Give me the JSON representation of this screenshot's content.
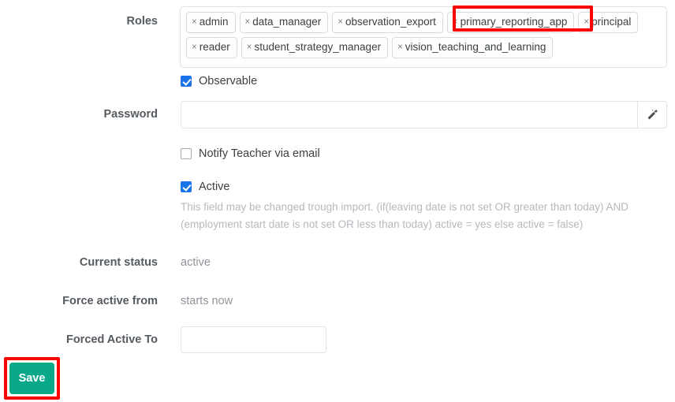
{
  "colors": {
    "accent_blue": "#1a73e8",
    "save_green": "#0aa88a",
    "highlight_red": "#ff0000",
    "border_grey": "#e2e4e7",
    "muted_text": "#8f9499"
  },
  "form": {
    "roles": {
      "label": "Roles",
      "remove_glyph": "×",
      "tags": [
        {
          "label": "admin",
          "highlighted": false
        },
        {
          "label": "data_manager",
          "highlighted": false
        },
        {
          "label": "observation_export",
          "highlighted": false
        },
        {
          "label": "primary_reporting_app",
          "highlighted": true
        },
        {
          "label": "principal",
          "highlighted": false
        },
        {
          "label": "reader",
          "highlighted": false
        },
        {
          "label": "student_strategy_manager",
          "highlighted": false
        },
        {
          "label": "vision_teaching_and_learning",
          "highlighted": false
        }
      ]
    },
    "observable": {
      "label": "Observable",
      "checked": true
    },
    "password": {
      "label": "Password",
      "value": "",
      "placeholder": "",
      "generate_icon": "magic-wand-icon"
    },
    "notify_teacher": {
      "label": "Notify Teacher via email",
      "checked": false
    },
    "active": {
      "label": "Active",
      "checked": true,
      "help": "This field may be changed trough import. (if(leaving date is not set OR greater than today) AND (employment start date is not set OR less than today) active = yes else active = false)"
    },
    "current_status": {
      "label": "Current status",
      "value": "active"
    },
    "force_active_from": {
      "label": "Force active from",
      "value": "starts now"
    },
    "forced_active_to": {
      "label": "Forced Active To",
      "value": "",
      "placeholder": ""
    },
    "save": {
      "label": "Save"
    }
  }
}
